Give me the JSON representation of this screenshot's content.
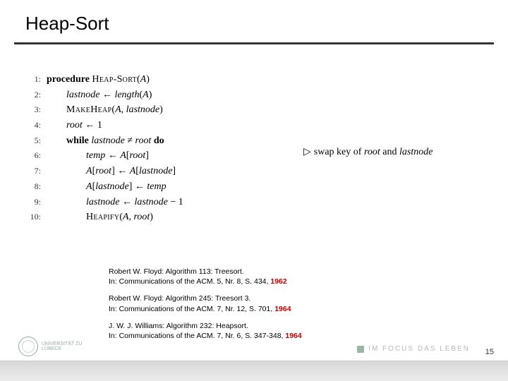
{
  "title": "Heap-Sort",
  "algorithm": {
    "lines": [
      {
        "n": "1:",
        "indent": 0,
        "html": "<span class='kw'>procedure</span> <span class='sc'>Heap-Sort</span>(<span class='it'>A</span>)"
      },
      {
        "n": "2:",
        "indent": 1,
        "html": "<span class='it'>lastnode</span> ← <span class='it'>length</span>(<span class='it'>A</span>)"
      },
      {
        "n": "3:",
        "indent": 1,
        "html": "<span class='sc'>MakeHeap</span>(<span class='it'>A</span>, <span class='it'>lastnode</span>)"
      },
      {
        "n": "4:",
        "indent": 1,
        "html": "<span class='it'>root</span> ← 1"
      },
      {
        "n": "5:",
        "indent": 1,
        "html": "<span class='kw'>while</span> <span class='it'>lastnode</span> ≠ <span class='it'>root</span> <span class='kw'>do</span>"
      },
      {
        "n": "6:",
        "indent": 2,
        "html": "<span class='it'>temp</span> ← <span class='it'>A</span>[<span class='it'>root</span>]"
      },
      {
        "n": "7:",
        "indent": 2,
        "html": "<span class='it'>A</span>[<span class='it'>root</span>] ← <span class='it'>A</span>[<span class='it'>lastnode</span>]"
      },
      {
        "n": "8:",
        "indent": 2,
        "html": "<span class='it'>A</span>[<span class='it'>lastnode</span>] ← <span class='it'>temp</span>"
      },
      {
        "n": "9:",
        "indent": 2,
        "html": "<span class='it'>lastnode</span> ← <span class='it'>lastnode</span> − 1"
      },
      {
        "n": "10:",
        "indent": 2,
        "html": "<span class='sc'>Heapify</span>(<span class='it'>A</span>, <span class='it'>root</span>)"
      }
    ],
    "comment_prefix": "▷",
    "comment": "swap key of <span class='it'>root</span> and <span class='it'>lastnode</span>"
  },
  "references": [
    {
      "line1": "Robert W. Floyd: Algorithm 113: Treesort.",
      "line2": "In: Communications of the ACM. 5, Nr. 8, S. 434, ",
      "year": "1962"
    },
    {
      "line1": "Robert W. Floyd: Algorithm 245: Treesort 3.",
      "line2": "In: Communications of the ACM. 7, Nr. 12, S. 701, ",
      "year": "1964"
    },
    {
      "line1": "J. W. J. Williams: Algorithm 232: Heapsort.",
      "line2": "In: Communications of the ACM. 7, Nr. 6, S. 347-348, ",
      "year": "1964"
    }
  ],
  "footer": {
    "left_logo_text": "UNIVERSITÄT ZU LÜBECK",
    "right_logo_text": "IM FOCUS DAS LEBEN",
    "page_number": "15"
  }
}
